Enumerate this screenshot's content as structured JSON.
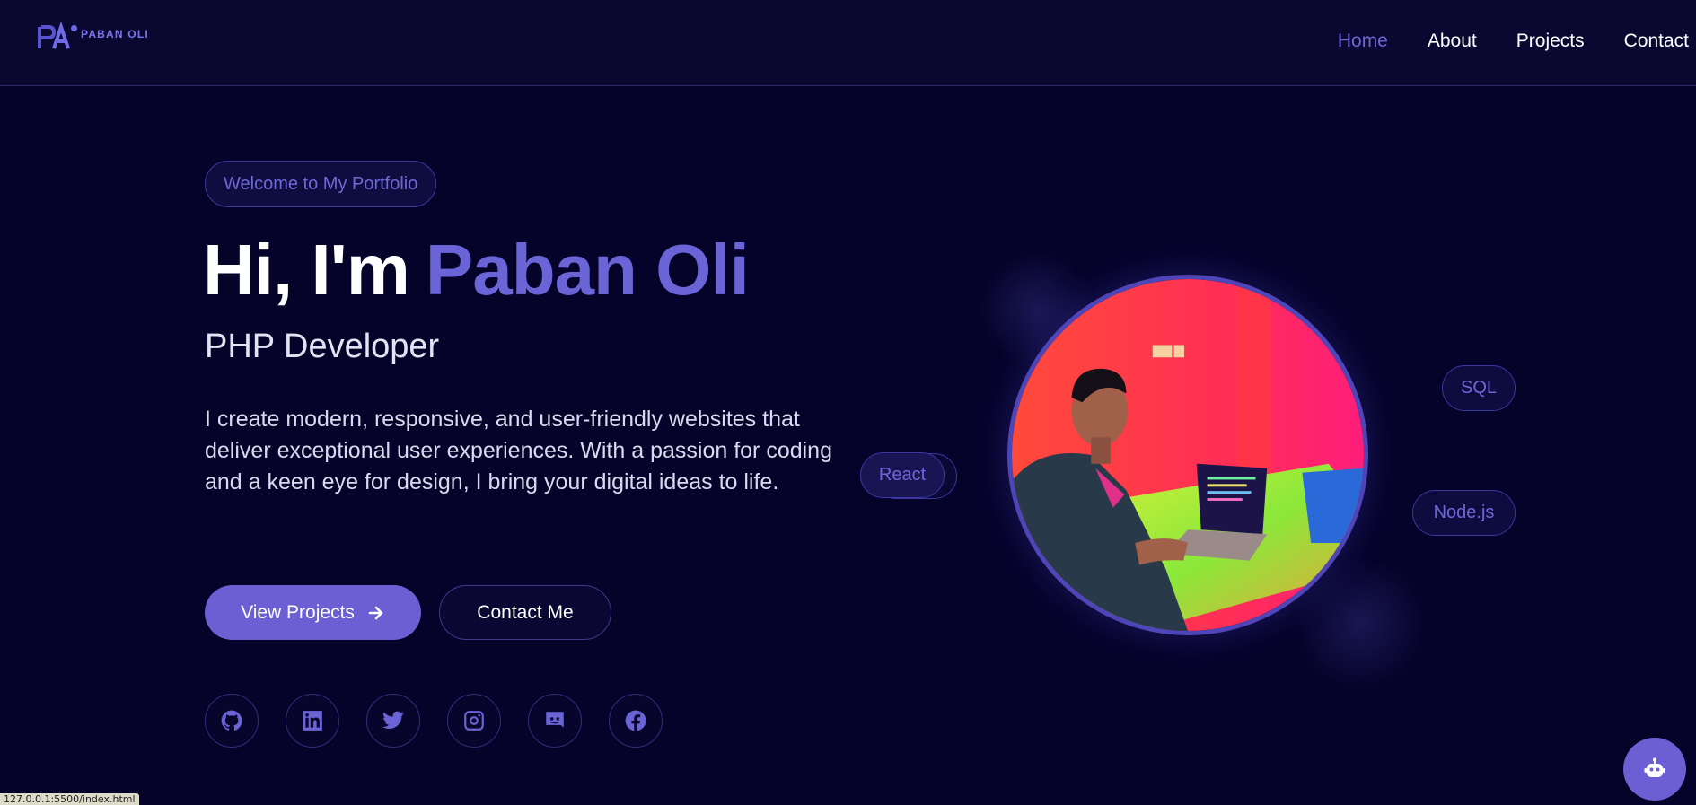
{
  "brand": {
    "logo_text": "PABAN OLI",
    "accent": "#6c66d8"
  },
  "nav": {
    "items": [
      {
        "label": "Home",
        "active": true
      },
      {
        "label": "About",
        "active": false
      },
      {
        "label": "Projects",
        "active": false
      },
      {
        "label": "Contact",
        "active": false
      }
    ]
  },
  "hero": {
    "welcome": "Welcome to My Portfolio",
    "greeting": "Hi, I'm",
    "name": "Paban Oli",
    "role": "PHP Developer",
    "description": "I create modern, responsive, and user-friendly websites that deliver exceptional user experiences. With a passion for coding and a keen eye for design, I bring your digital ideas to life.",
    "primary_button": "View Projects",
    "secondary_button": "Contact Me"
  },
  "socials": [
    {
      "icon": "github-icon"
    },
    {
      "icon": "linkedin-icon"
    },
    {
      "icon": "twitter-icon"
    },
    {
      "icon": "instagram-icon"
    },
    {
      "icon": "discord-icon"
    },
    {
      "icon": "facebook-icon"
    }
  ],
  "skills": {
    "react": "React",
    "sql": "SQL",
    "node": "Node.js"
  },
  "chatbot": {
    "icon": "robot-icon"
  },
  "status_bar": {
    "url": "127.0.0.1:5500/index.html"
  }
}
